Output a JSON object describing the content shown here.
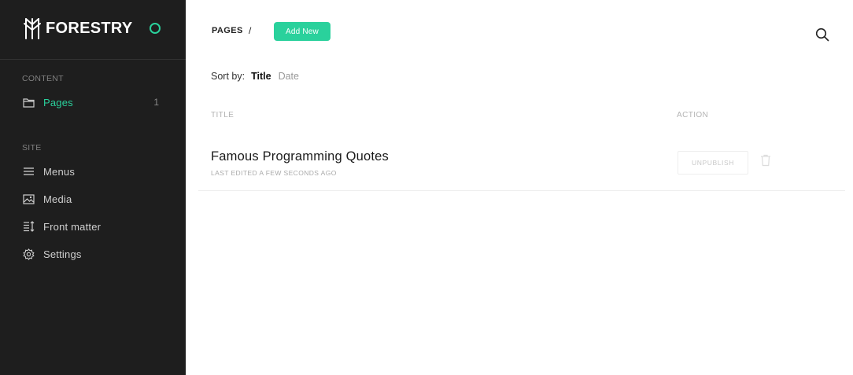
{
  "app": {
    "brand_name": "FORESTRY",
    "status_color": "#2ad19c"
  },
  "sidebar": {
    "sections": [
      {
        "label": "CONTENT"
      },
      {
        "label": "SITE"
      }
    ],
    "items": [
      {
        "label": "Pages",
        "icon": "folder-icon",
        "count": "1",
        "active": true
      },
      {
        "label": "Menus",
        "icon": "menu-icon"
      },
      {
        "label": "Media",
        "icon": "image-icon"
      },
      {
        "label": "Front matter",
        "icon": "front-matter-icon"
      },
      {
        "label": "Settings",
        "icon": "gear-icon"
      }
    ]
  },
  "header": {
    "breadcrumb": "PAGES",
    "separator": "/",
    "add_button": "Add New",
    "search_icon": "search-icon"
  },
  "sort": {
    "label": "Sort by:",
    "options": [
      "Title",
      "Date"
    ],
    "selected": "Title"
  },
  "table": {
    "columns": [
      "TITLE",
      "ACTION"
    ],
    "rows": [
      {
        "title": "Famous Programming Quotes",
        "subtitle": "LAST EDITED A FEW SECONDS AGO",
        "action": "UNPUBLISH",
        "delete_icon": "trash-icon"
      }
    ]
  },
  "colors": {
    "accent": "#2ad19c",
    "sidebar_bg": "#1e1e1e"
  }
}
